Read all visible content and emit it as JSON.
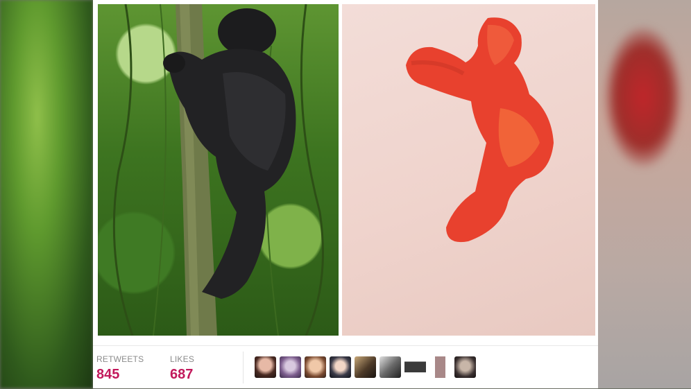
{
  "tweet": {
    "retweets_label": "RETWEETS",
    "retweets_count": "845",
    "likes_label": "LIKES",
    "likes_count": "687"
  },
  "images": [
    {
      "subject": "gorilla-photo"
    },
    {
      "subject": "cheeto-photo"
    }
  ],
  "avatars": [
    {
      "name": "avatar-1"
    },
    {
      "name": "avatar-2"
    },
    {
      "name": "avatar-3"
    },
    {
      "name": "avatar-4"
    },
    {
      "name": "avatar-5"
    },
    {
      "name": "avatar-6"
    },
    {
      "name": "avatar-7"
    },
    {
      "name": "avatar-8"
    },
    {
      "name": "avatar-9"
    }
  ],
  "colors": {
    "count_accent": "#c2185b",
    "label_gray": "#8a8a8a"
  }
}
